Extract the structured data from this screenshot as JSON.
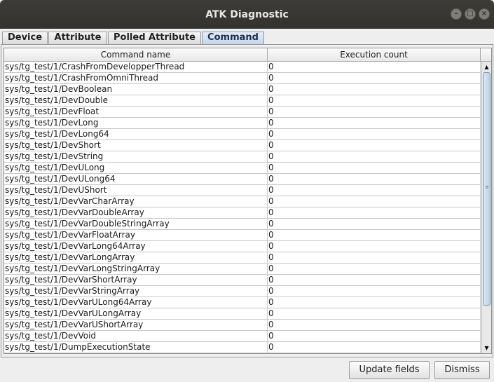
{
  "window": {
    "title": "ATK Diagnostic",
    "controls": [
      "minimize-icon",
      "maximize-icon",
      "close-icon"
    ]
  },
  "tabs": [
    {
      "label": "Device",
      "active": false
    },
    {
      "label": "Attribute",
      "active": false
    },
    {
      "label": "Polled Attribute",
      "active": false
    },
    {
      "label": "Command",
      "active": true
    }
  ],
  "table": {
    "columns": [
      "Command name",
      "Execution count"
    ],
    "rows": [
      [
        "sys/tg_test/1/CrashFromDevelopperThread",
        "0"
      ],
      [
        "sys/tg_test/1/CrashFromOmniThread",
        "0"
      ],
      [
        "sys/tg_test/1/DevBoolean",
        "0"
      ],
      [
        "sys/tg_test/1/DevDouble",
        "0"
      ],
      [
        "sys/tg_test/1/DevFloat",
        "0"
      ],
      [
        "sys/tg_test/1/DevLong",
        "0"
      ],
      [
        "sys/tg_test/1/DevLong64",
        "0"
      ],
      [
        "sys/tg_test/1/DevShort",
        "0"
      ],
      [
        "sys/tg_test/1/DevString",
        "0"
      ],
      [
        "sys/tg_test/1/DevULong",
        "0"
      ],
      [
        "sys/tg_test/1/DevULong64",
        "0"
      ],
      [
        "sys/tg_test/1/DevUShort",
        "0"
      ],
      [
        "sys/tg_test/1/DevVarCharArray",
        "0"
      ],
      [
        "sys/tg_test/1/DevVarDoubleArray",
        "0"
      ],
      [
        "sys/tg_test/1/DevVarDoubleStringArray",
        "0"
      ],
      [
        "sys/tg_test/1/DevVarFloatArray",
        "0"
      ],
      [
        "sys/tg_test/1/DevVarLong64Array",
        "0"
      ],
      [
        "sys/tg_test/1/DevVarLongArray",
        "0"
      ],
      [
        "sys/tg_test/1/DevVarLongStringArray",
        "0"
      ],
      [
        "sys/tg_test/1/DevVarShortArray",
        "0"
      ],
      [
        "sys/tg_test/1/DevVarStringArray",
        "0"
      ],
      [
        "sys/tg_test/1/DevVarULong64Array",
        "0"
      ],
      [
        "sys/tg_test/1/DevVarULongArray",
        "0"
      ],
      [
        "sys/tg_test/1/DevVarUShortArray",
        "0"
      ],
      [
        "sys/tg_test/1/DevVoid",
        "0"
      ],
      [
        "sys/tg_test/1/DumpExecutionState",
        "0"
      ]
    ]
  },
  "buttons": {
    "update_label": "Update fields",
    "dismiss_label": "Dismiss"
  },
  "colors": {
    "titlebar": "#3d3c38",
    "active_tab": "#c4d5ea",
    "scroll_thumb": "#bcd0e8"
  }
}
